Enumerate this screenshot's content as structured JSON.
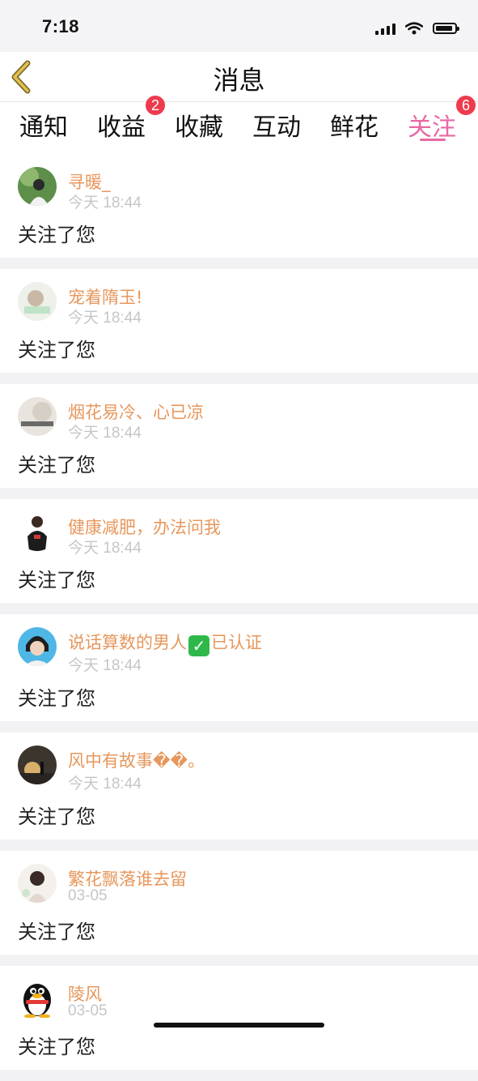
{
  "status_bar": {
    "time": "7:18"
  },
  "nav": {
    "title": "消息"
  },
  "tabs": [
    {
      "label": "通知"
    },
    {
      "label": "收益",
      "badge": "2"
    },
    {
      "label": "收藏"
    },
    {
      "label": "互动"
    },
    {
      "label": "鲜花"
    },
    {
      "label": "关注",
      "badge": "6",
      "active": true
    }
  ],
  "feed": [
    {
      "name": "寻暖_",
      "time": "今天 18:44",
      "action": "关注了您"
    },
    {
      "name": "宠着隋玉!",
      "time": "今天 18:44",
      "action": "关注了您"
    },
    {
      "name": "烟花易冷、心已凉",
      "time": "今天 18:44",
      "action": "关注了您"
    },
    {
      "name": "健康减肥，办法问我",
      "time": "今天 18:44",
      "action": "关注了您"
    },
    {
      "name_prefix": "说话算数的男人",
      "verified_icon": "check-mark-icon",
      "name_suffix": "已认证",
      "time": "今天 18:44",
      "action": "关注了您"
    },
    {
      "name": "风中有故事��。",
      "time": "今天 18:44",
      "action": "关注了您"
    },
    {
      "name": "繁花飘落谁去留",
      "time": "03-05",
      "action": "关注了您"
    },
    {
      "name": "陵风",
      "time": "03-05",
      "action": "关注了您"
    }
  ],
  "colors": {
    "accent": "#e968a3",
    "username": "#e7975c",
    "badge": "#ee3b4d",
    "back_arrow": "#d6b046"
  }
}
